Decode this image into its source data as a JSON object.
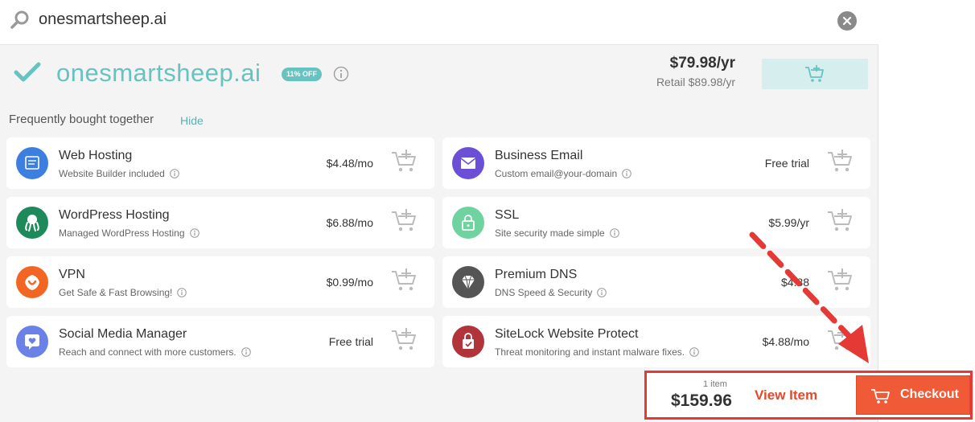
{
  "search": {
    "query": "onesmartsheep.ai"
  },
  "domain": {
    "name": "onesmartsheep.ai",
    "badge": "11% OFF",
    "price": "$79.98/yr",
    "retail": "Retail $89.98/yr"
  },
  "bundle": {
    "label": "Frequently bought together",
    "hide": "Hide"
  },
  "products": [
    {
      "title": "Web Hosting",
      "subtitle": "Website Builder included",
      "price": "$4.48/mo",
      "icon": "browser-window-icon",
      "color": "#3d7fe0"
    },
    {
      "title": "Business Email",
      "subtitle": "Custom email@your-domain",
      "price": "Free trial",
      "icon": "envelope-icon",
      "color": "#6b4fd6"
    },
    {
      "title": "WordPress Hosting",
      "subtitle": "Managed WordPress Hosting",
      "price": "$6.88/mo",
      "icon": "octopus-icon",
      "color": "#1e8a5c"
    },
    {
      "title": "SSL",
      "subtitle": "Site security made simple",
      "price": "$5.99/yr",
      "icon": "padlock-icon",
      "color": "#6fd3a0"
    },
    {
      "title": "VPN",
      "subtitle": "Get Safe & Fast Browsing!",
      "price": "$0.99/mo",
      "icon": "vpn-shield-icon",
      "color": "#f26522"
    },
    {
      "title": "Premium DNS",
      "subtitle": "DNS Speed & Security",
      "price": "$4.88",
      "icon": "diamond-icon",
      "color": "#555555"
    },
    {
      "title": "Social Media Manager",
      "subtitle": "Reach and connect with more customers.",
      "price": "Free trial",
      "icon": "chat-heart-icon",
      "color": "#6a82e8"
    },
    {
      "title": "SiteLock Website Protect",
      "subtitle": "Threat monitoring and instant malware fixes.",
      "price": "$4.88/mo",
      "icon": "sitelock-icon",
      "color": "#b0343a"
    }
  ],
  "cart": {
    "items": "1 item",
    "total": "$159.96",
    "view_item": "View Item",
    "checkout": "Checkout"
  },
  "colors": {
    "accent": "#66c3c0",
    "checkout": "#f05a36",
    "annotation": "#e53935"
  }
}
